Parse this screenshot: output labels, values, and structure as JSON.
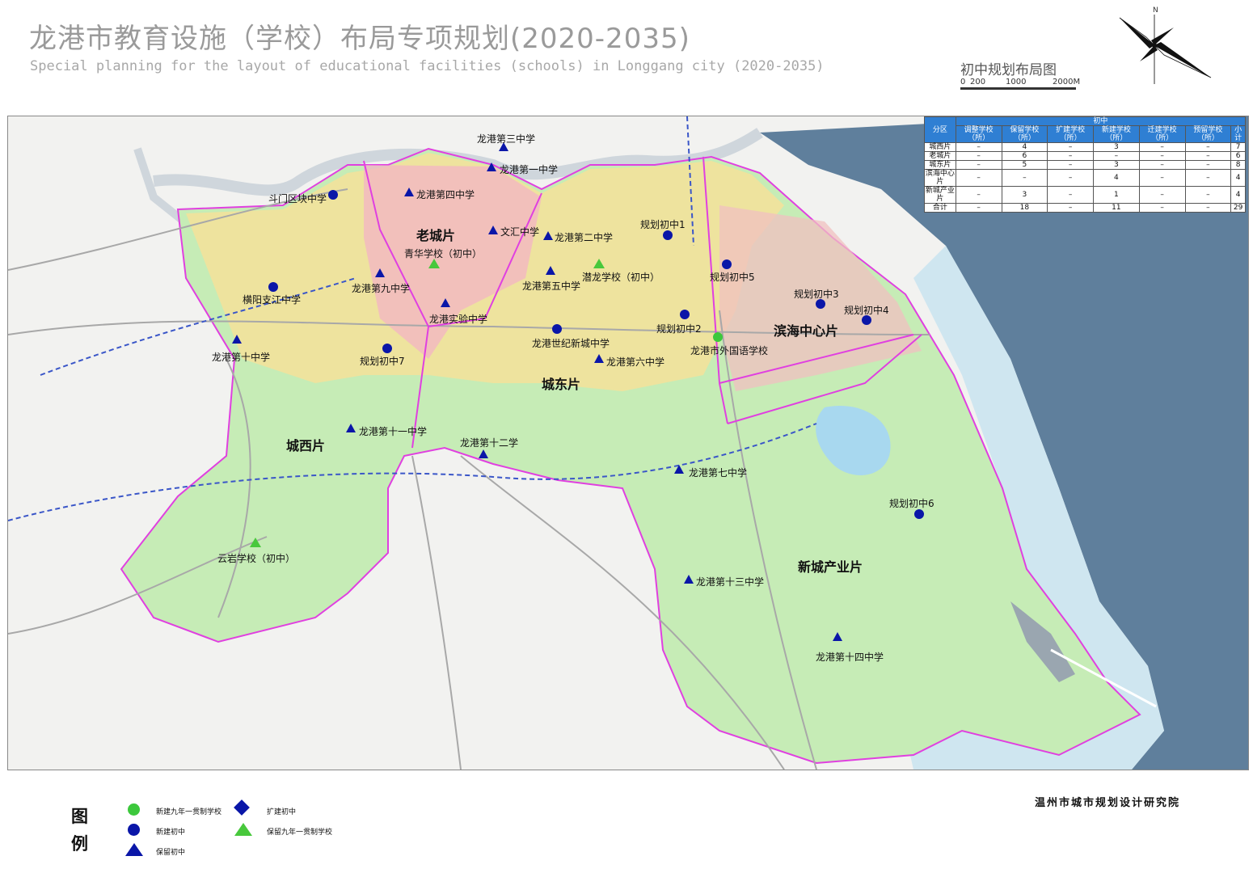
{
  "title": {
    "cn": "龙港市教育设施（学校）布局专项规划(2020-2035)",
    "en": "Special planning for the layout of educational facilities (schools) in Longgang city (2020-2035)"
  },
  "map_label": "初中规划布局图",
  "scale_bar": {
    "ticks": [
      "0",
      "200",
      "1000",
      "2000M"
    ]
  },
  "compass": {
    "north_label": "N"
  },
  "districts": [
    "老城片",
    "城东片",
    "城西片",
    "滨海中心片",
    "新城产业片"
  ],
  "schools": [
    {
      "name": "龙港第三中学",
      "type": "保留初中"
    },
    {
      "name": "龙港第一中学",
      "type": "保留初中"
    },
    {
      "name": "龙港第四中学",
      "type": "保留初中"
    },
    {
      "name": "斗门区块中学",
      "type": "新建初中"
    },
    {
      "name": "文汇中学",
      "type": "保留初中"
    },
    {
      "name": "龙港第二中学",
      "type": "保留初中"
    },
    {
      "name": "规划初中1",
      "type": "新建初中"
    },
    {
      "name": "青华学校（初中）",
      "type": "保留九年一贯制学校"
    },
    {
      "name": "龙港第九中学",
      "type": "保留初中"
    },
    {
      "name": "潜龙学校（初中）",
      "type": "保留九年一贯制学校"
    },
    {
      "name": "龙港第五中学",
      "type": "保留初中"
    },
    {
      "name": "规划初中5",
      "type": "新建初中"
    },
    {
      "name": "横阳支江中学",
      "type": "新建初中"
    },
    {
      "name": "龙港实验中学",
      "type": "保留初中"
    },
    {
      "name": "规划初中3",
      "type": "新建初中"
    },
    {
      "name": "规划初中4",
      "type": "新建初中"
    },
    {
      "name": "规划初中2",
      "type": "新建初中"
    },
    {
      "name": "龙港世纪新城中学",
      "type": "新建初中"
    },
    {
      "name": "龙港市外国语学校",
      "type": "新建九年一贯制学校"
    },
    {
      "name": "龙港第十中学",
      "type": "保留初中"
    },
    {
      "name": "规划初中7",
      "type": "新建初中"
    },
    {
      "name": "龙港第六中学",
      "type": "保留初中"
    },
    {
      "name": "龙港第十一中学",
      "type": "保留初中"
    },
    {
      "name": "龙港第十二学",
      "type": "保留初中"
    },
    {
      "name": "龙港第七中学",
      "type": "保留初中"
    },
    {
      "name": "规划初中6",
      "type": "新建初中"
    },
    {
      "name": "云岩学校（初中）",
      "type": "保留九年一贯制学校"
    },
    {
      "name": "龙港第十三中学",
      "type": "保留初中"
    },
    {
      "name": "龙港第十四中学",
      "type": "保留初中"
    }
  ],
  "table": {
    "corner": "分区",
    "group": "初中",
    "columns": [
      "调整学校（所）",
      "保留学校（所）",
      "扩建学校（所）",
      "新建学校（所）",
      "迁建学校（所）",
      "预留学校（所）",
      "小计"
    ],
    "rows": [
      {
        "zone": "城西片",
        "values": [
          "–",
          "4",
          "–",
          "3",
          "–",
          "–",
          "7"
        ]
      },
      {
        "zone": "老城片",
        "values": [
          "–",
          "6",
          "–",
          "–",
          "–",
          "–",
          "6"
        ]
      },
      {
        "zone": "城东片",
        "values": [
          "–",
          "5",
          "–",
          "3",
          "–",
          "–",
          "8"
        ]
      },
      {
        "zone": "滨海中心片",
        "values": [
          "–",
          "–",
          "–",
          "4",
          "–",
          "–",
          "4"
        ]
      },
      {
        "zone": "新城产业片",
        "values": [
          "–",
          "3",
          "–",
          "1",
          "–",
          "–",
          "4"
        ]
      },
      {
        "zone": "合计",
        "values": [
          "–",
          "18",
          "–",
          "11",
          "–",
          "–",
          "29"
        ]
      }
    ]
  },
  "legend": {
    "title": [
      "图",
      "例"
    ],
    "items": [
      "新建九年一贯制学校",
      "新建初中",
      "保留初中",
      "扩建初中",
      "保留九年一贯制学校"
    ]
  },
  "institute": "温州市城市规划设计研究院",
  "colors": {
    "keep_junior": "#0a16a8",
    "new_junior": "#0a16a8",
    "new_nine_year": "#3cc83c",
    "keep_nine_year": "#48c83c",
    "district_boundary": "#e040e0",
    "sea": "#5f7f9c",
    "table_header": "#2f7fd3"
  }
}
